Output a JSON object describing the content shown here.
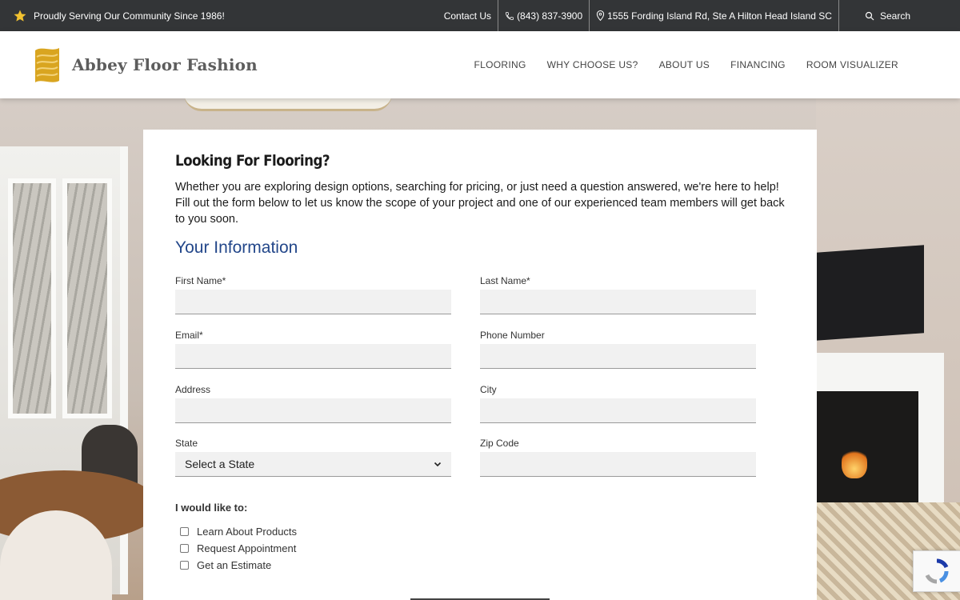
{
  "topbar": {
    "tagline": "Proudly Serving Our Community Since 1986!",
    "contact": "Contact Us",
    "phone": "(843) 837-3900",
    "address": "1555 Fording Island Rd, Ste A Hilton Head Island SC",
    "search": "Search"
  },
  "header": {
    "brand": "Abbey Floor Fashion",
    "nav": [
      "FLOORING",
      "WHY CHOOSE US?",
      "ABOUT US",
      "FINANCING",
      "ROOM VISUALIZER"
    ]
  },
  "form": {
    "title": "Looking For Flooring?",
    "intro": "Whether you are exploring design options, searching for pricing, or just need a question answered, we're here to help! Fill out the form below to let us know the scope of your project and one of our experienced team members will get back to you soon.",
    "section": "Your Information",
    "fields": {
      "first_name": "First Name*",
      "last_name": "Last Name*",
      "email": "Email*",
      "phone": "Phone Number",
      "address": "Address",
      "city": "City",
      "state": "State",
      "zip": "Zip Code"
    },
    "state_selected": "Select a State",
    "wish_label": "I would like to:",
    "options": [
      "Learn About Products",
      "Request Appointment",
      "Get an Estimate"
    ]
  },
  "colors": {
    "topbar_bg": "#333537",
    "section_heading": "#23478a",
    "star": "#f2c230",
    "logo_gold": "#d9a520"
  }
}
